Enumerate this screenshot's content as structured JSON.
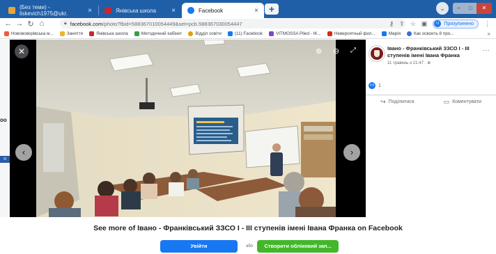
{
  "browser": {
    "tabs": [
      {
        "title": "(Без теми) - liskevich1975@ukr.",
        "color": "#e8a43a"
      },
      {
        "title": "Янівська школа",
        "color": "#c8262f"
      },
      {
        "title": "Facebook",
        "color": "#1877f2"
      }
    ],
    "new_tab": "+",
    "url_host": "facebook.com",
    "url_path": "/photo?fbid=588367010054449&set=pcb.588367030054447",
    "profile_label": "Призупинено",
    "profile_initial": "U",
    "bookmarks": [
      {
        "label": "Новововорівська м...",
        "color": "#e85d3a"
      },
      {
        "label": "Заняття",
        "color": "#f0b429"
      },
      {
        "label": "Янівська школа",
        "color": "#c8262f"
      },
      {
        "label": "Методичний кабінет",
        "color": "#3a9c4a"
      },
      {
        "label": "Відділ освіти",
        "color": "#e0a000"
      },
      {
        "label": "(11) Facebook",
        "color": "#1877f2"
      },
      {
        "label": "VITMOSSA Plied - IK...",
        "color": "#7b4bc4"
      },
      {
        "label": "Невероятный фил...",
        "color": "#e0241b"
      },
      {
        "label": "Марія",
        "color": "#1877f2"
      },
      {
        "label": "Как освоить 8 про...",
        "color": "#3f6fd1"
      }
    ]
  },
  "viewer": {
    "ghost_text": "oo",
    "ghost_chip": "N",
    "slide_lines": 7
  },
  "post": {
    "page_name": "Івано - Франківський ЗЗСО І - ІІІ ступенів імені Івана Франка",
    "date": "11 травень о 21:47 · ",
    "reaction_count": "1",
    "share_label": "Поділитися",
    "comment_label": "Коментувати"
  },
  "cta": {
    "see_more": "See more of Івано - Франківський ЗЗСО І - ІІІ ступенів імені Івана Франка on Facebook",
    "login": "Увійти",
    "or": "або",
    "create": "Створити обліковий зап..."
  },
  "colors": {
    "facebook_blue": "#1877f2",
    "create_green": "#42b72a",
    "tabstrip": "#1f5fa8"
  }
}
